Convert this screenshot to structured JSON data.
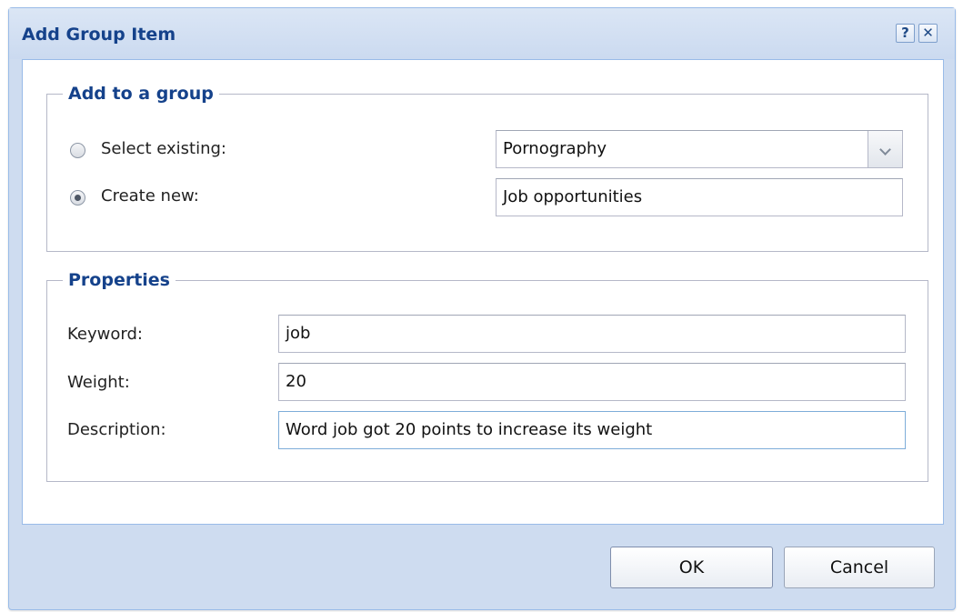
{
  "dialog": {
    "title": "Add Group Item",
    "help_icon": "help-icon",
    "help_glyph": "?",
    "close_icon": "close-icon",
    "close_glyph": "✕"
  },
  "add_to_group": {
    "legend": "Add to a group",
    "select_existing": {
      "label": "Select existing:",
      "selected": false,
      "value": "Pornography"
    },
    "create_new": {
      "label": "Create new:",
      "selected": true,
      "value": "Job opportunities"
    }
  },
  "properties": {
    "legend": "Properties",
    "keyword": {
      "label": "Keyword:",
      "value": "job"
    },
    "weight": {
      "label": "Weight:",
      "value": "20"
    },
    "description": {
      "label": "Description:",
      "value": "Word job got 20 points to increase its weight"
    }
  },
  "buttons": {
    "ok": "OK",
    "cancel": "Cancel"
  }
}
